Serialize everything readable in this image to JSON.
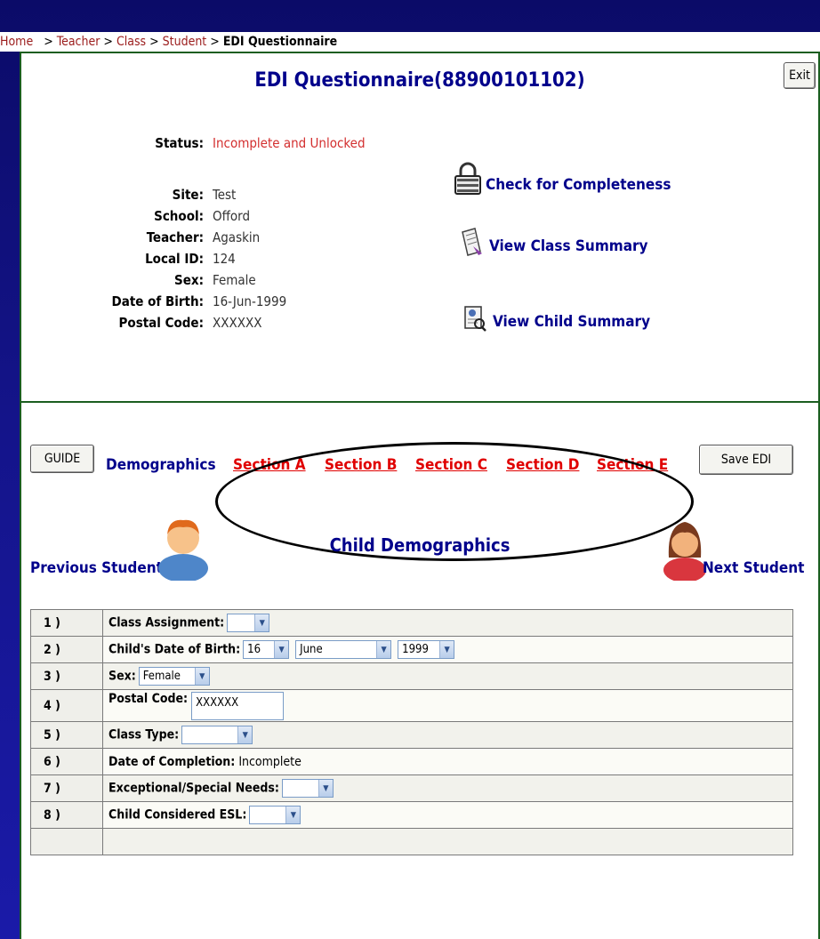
{
  "breadcrumb": {
    "items": [
      "Home",
      "Teacher",
      "Class",
      "Student"
    ],
    "separator": ">",
    "current": "EDI Questionnaire"
  },
  "header": {
    "title": "EDI Questionnaire(88900101102)",
    "exit_label": "Exit"
  },
  "info": {
    "status_label": "Status:",
    "status_value": "Incomplete and Unlocked",
    "site_label": "Site:",
    "site_value": "Test",
    "school_label": "School:",
    "school_value": "Offord",
    "teacher_label": "Teacher:",
    "teacher_value": "Agaskin",
    "localid_label": "Local ID:",
    "localid_value": "124",
    "sex_label": "Sex:",
    "sex_value": "Female",
    "dob_label": "Date of Birth:",
    "dob_value": "16-Jun-1999",
    "postal_label": "Postal Code:",
    "postal_value": "XXXXXX"
  },
  "actions": {
    "check": "Check for Completeness",
    "class_summary": "View Class Summary",
    "child_summary": "View Child Summary"
  },
  "nav": {
    "guide": "GUIDE",
    "demographics": "Demographics",
    "sections": [
      "Section A",
      "Section B",
      "Section C",
      "Section D",
      "Section E"
    ],
    "save": "Save EDI"
  },
  "child": {
    "heading": "Child Demographics",
    "previous": "Previous Student",
    "next": "Next Student"
  },
  "questions": [
    {
      "num": "1 )",
      "label": "Class Assignment:",
      "value": ""
    },
    {
      "num": "2 )",
      "label": "Child's Date of Birth:",
      "day": "16",
      "month": "June",
      "year": "1999"
    },
    {
      "num": "3 )",
      "label": "Sex:",
      "value": "Female"
    },
    {
      "num": "4 )",
      "label": "Postal Code:",
      "value": "XXXXXX"
    },
    {
      "num": "5 )",
      "label": "Class Type:",
      "value": ""
    },
    {
      "num": "6 )",
      "label": "Date of Completion:",
      "value": "Incomplete"
    },
    {
      "num": "7 )",
      "label": "Exceptional/Special Needs:",
      "value": ""
    },
    {
      "num": "8 )",
      "label": "Child Considered ESL:",
      "value": ""
    }
  ],
  "colors": {
    "accent_navy": "#00008b",
    "link_red": "#e00000",
    "border_green": "#1b5e20"
  }
}
